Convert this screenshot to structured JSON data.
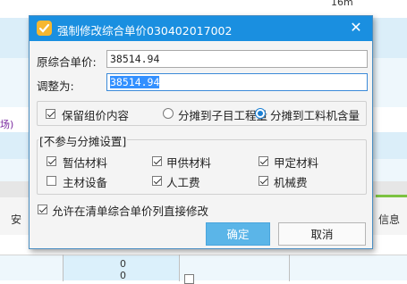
{
  "background": {
    "top_right_text": "16m",
    "left_text": "场)",
    "col_header_left": "安",
    "col_header_right": "信息",
    "row_values": [
      "0",
      "0"
    ]
  },
  "dialog": {
    "title": "强制修改综合单价030402017002",
    "close_symbol": "✕",
    "original_price_label": "原综合单价:",
    "original_price_value": "38514.94",
    "adjust_label": "调整为:",
    "adjust_value": "38514.94",
    "keep_composition_label": "保留组价内容",
    "keep_composition_checked": true,
    "radio_sub_items_label": "分摊到子目工程量",
    "radio_labor_label": "分摊到工料机含量",
    "selected_radio": "labor",
    "group_title": "[不参与分摊设置]",
    "options": [
      {
        "label": "暂估材料",
        "checked": true
      },
      {
        "label": "甲供材料",
        "checked": true
      },
      {
        "label": "甲定材料",
        "checked": true
      },
      {
        "label": "主材设备",
        "checked": false
      },
      {
        "label": "人工费",
        "checked": true
      },
      {
        "label": "机械费",
        "checked": true
      }
    ],
    "allow_direct_edit_label": "允许在清单综合单价列直接修改",
    "allow_direct_edit_checked": true,
    "ok_label": "确定",
    "cancel_label": "取消"
  },
  "colors": {
    "titlebar": "#1a8fe0",
    "ok_button": "#5bb5e8",
    "selection": "#3390ff",
    "background_band": "#dbeef9"
  }
}
